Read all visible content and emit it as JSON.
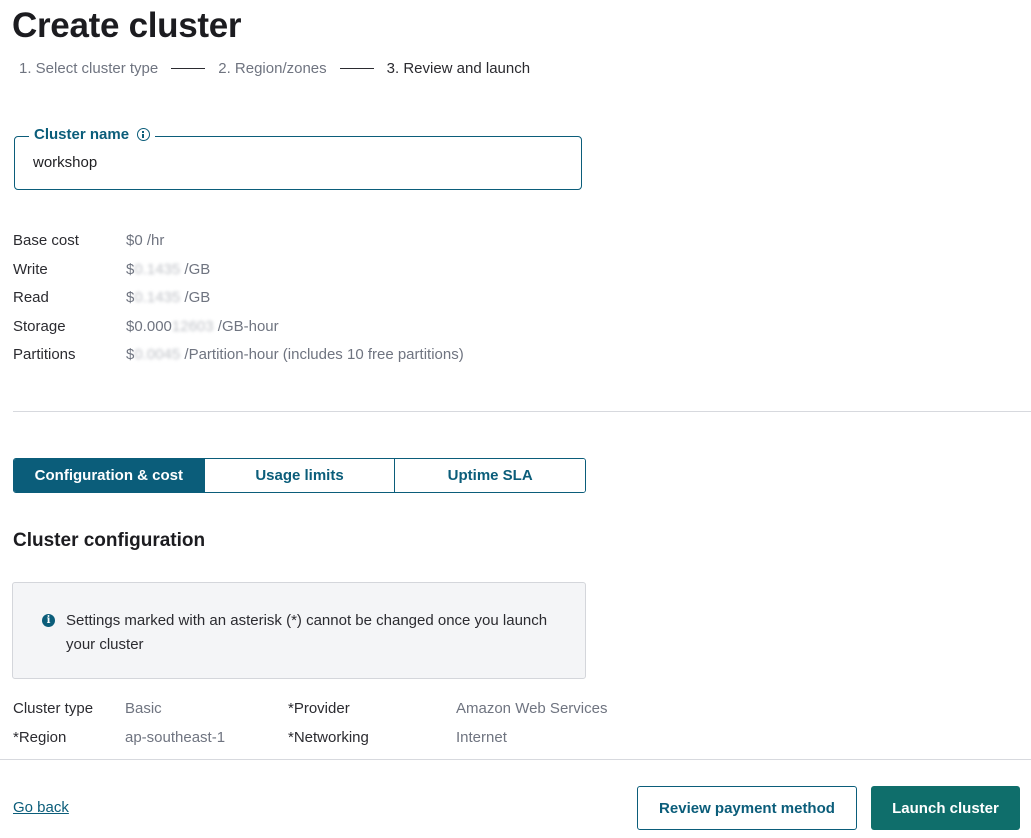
{
  "page": {
    "title": "Create cluster"
  },
  "stepper": {
    "steps": [
      {
        "label": "1. Select cluster type"
      },
      {
        "label": "2. Region/zones"
      },
      {
        "label": "3. Review and launch"
      }
    ]
  },
  "cluster_name": {
    "label": "Cluster name",
    "value": "workshop",
    "info_icon": "info-icon"
  },
  "costs": [
    {
      "label": "Base cost",
      "value_prefix": "$0",
      "value_hidden": "",
      "value_suffix": " /hr"
    },
    {
      "label": "Write",
      "value_prefix": "$",
      "value_hidden": "0.1435",
      "value_suffix": " /GB"
    },
    {
      "label": "Read",
      "value_prefix": "$",
      "value_hidden": "0.1435",
      "value_suffix": " /GB"
    },
    {
      "label": "Storage",
      "value_prefix": "$0.000",
      "value_hidden": "12603",
      "value_suffix": " /GB-hour"
    },
    {
      "label": "Partitions",
      "value_prefix": "$",
      "value_hidden": "0.0045",
      "value_suffix": " /Partition-hour (includes 10 free partitions)"
    }
  ],
  "tabs": [
    {
      "label": "Configuration & cost",
      "active": true
    },
    {
      "label": "Usage limits",
      "active": false
    },
    {
      "label": "Uptime SLA",
      "active": false
    }
  ],
  "section": {
    "title": "Cluster configuration"
  },
  "notice": {
    "text": "Settings marked with an asterisk (*) cannot be changed once you launch your cluster",
    "icon": "info-filled-icon"
  },
  "config": {
    "rows": [
      {
        "k1": "Cluster type",
        "v1": "Basic",
        "k2": "*Provider",
        "v2": "Amazon Web Services"
      },
      {
        "k1": "*Region",
        "v1": "ap-southeast-1",
        "k2": "*Networking",
        "v2": "Internet"
      }
    ]
  },
  "footer": {
    "go_back": "Go back",
    "review_payment": "Review payment method",
    "launch": "Launch cluster"
  },
  "colors": {
    "accent": "#0b5d7a",
    "primary_button": "#0f6e6b",
    "notice_bg": "#f4f5f7"
  }
}
